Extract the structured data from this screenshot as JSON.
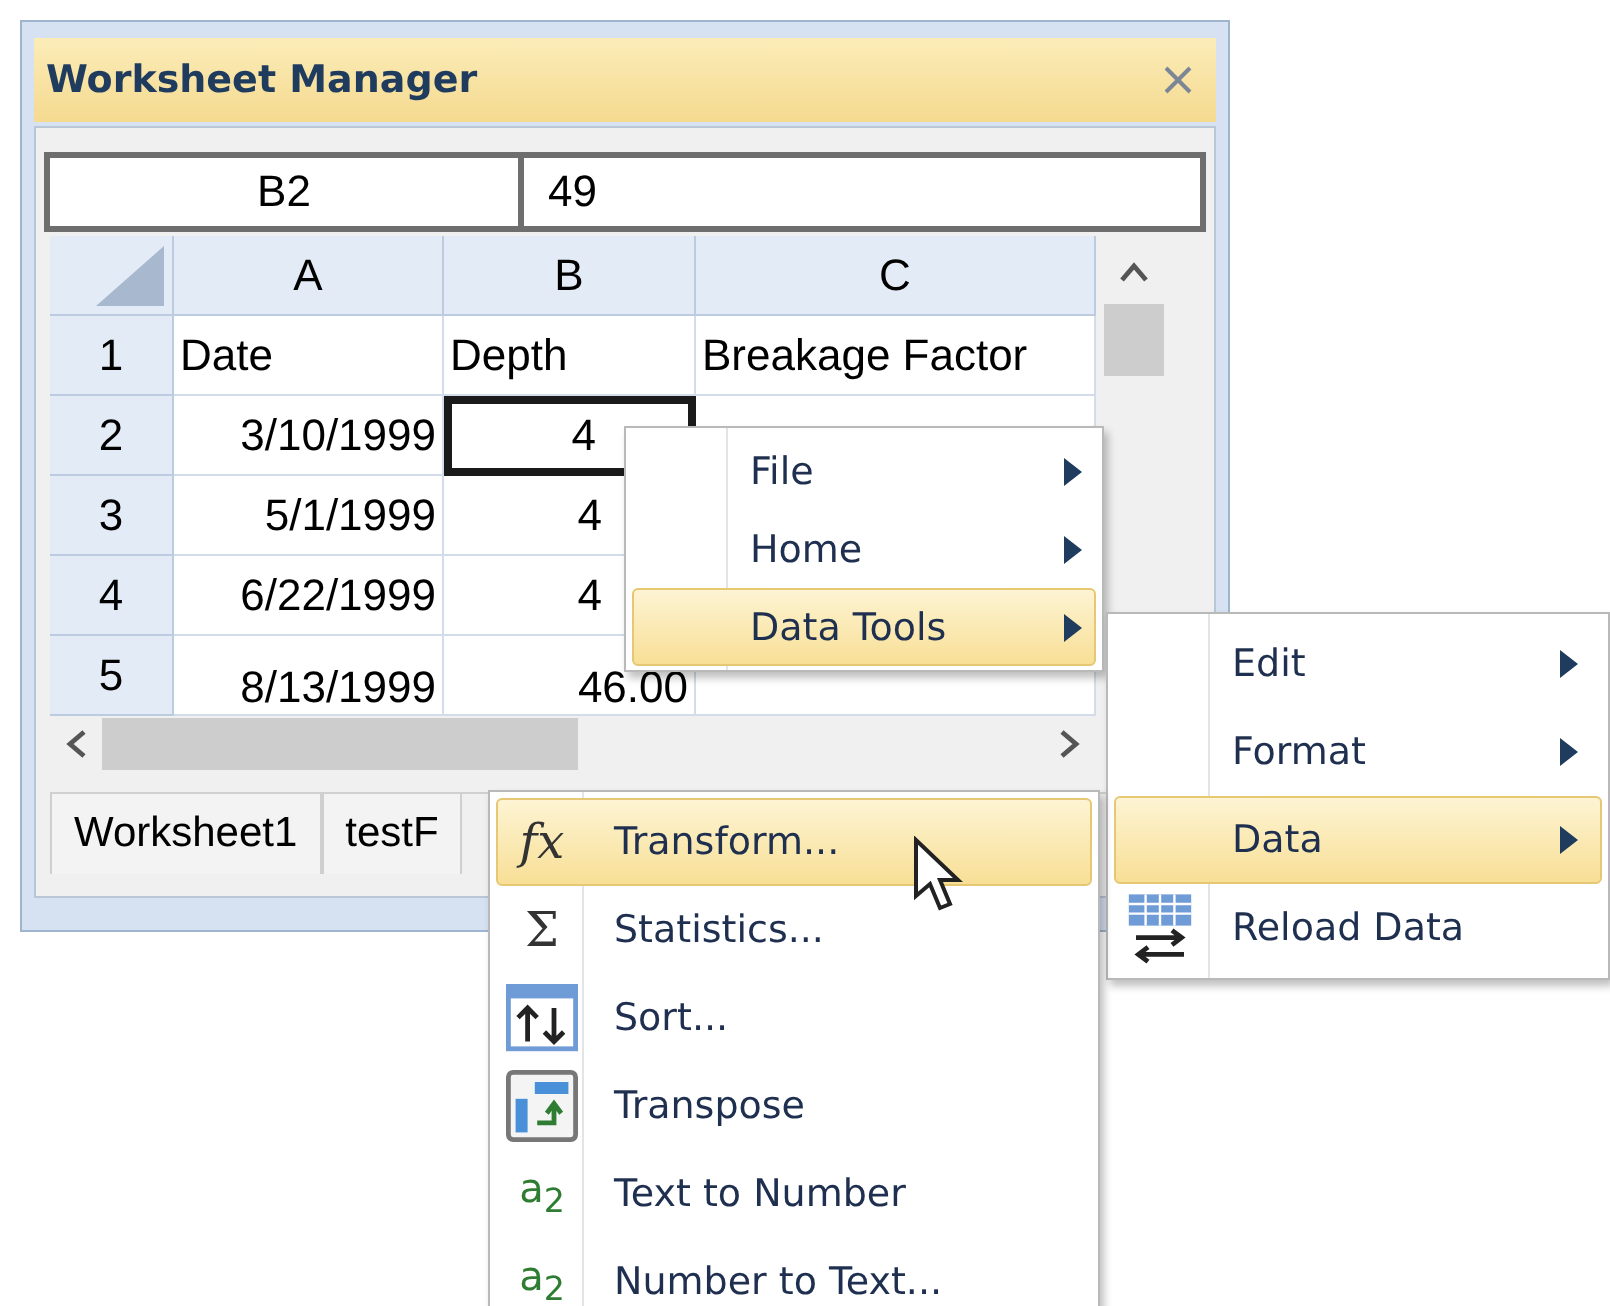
{
  "window": {
    "title": "Worksheet Manager"
  },
  "cell_reference": "B2",
  "cell_value": "49",
  "columns": [
    "A",
    "B",
    "C"
  ],
  "rows": [
    {
      "header": "1",
      "cells": [
        {
          "text": "Date",
          "kind": "text",
          "selected": false
        },
        {
          "text": "Depth",
          "kind": "text",
          "selected": false
        },
        {
          "text": "Breakage Factor",
          "kind": "text",
          "selected": false
        }
      ]
    },
    {
      "header": "2",
      "cells": [
        {
          "text": "3/10/1999",
          "kind": "number",
          "selected": false
        },
        {
          "text": "4",
          "kind": "covered",
          "selected": true
        }
      ]
    },
    {
      "header": "3",
      "cells": [
        {
          "text": "5/1/1999",
          "kind": "number",
          "selected": false
        },
        {
          "text": "4",
          "kind": "covered",
          "selected": false
        }
      ]
    },
    {
      "header": "4",
      "cells": [
        {
          "text": "6/22/1999",
          "kind": "number",
          "selected": false
        },
        {
          "text": "4",
          "kind": "covered",
          "selected": false
        }
      ]
    },
    {
      "header": "5",
      "cells": [
        {
          "text": "8/13/1999",
          "kind": "number",
          "selected": false
        },
        {
          "text": "46.00",
          "kind": "number",
          "selected": false
        },
        {
          "kind": "number",
          "selected": false
        }
      ]
    }
  ],
  "sheet_tabs": [
    "Worksheet1",
    "testF"
  ],
  "context_menu": {
    "items": [
      {
        "label": "File",
        "submenu": true,
        "selected": false
      },
      {
        "label": "Home",
        "submenu": true,
        "selected": false
      },
      {
        "label": "Data Tools",
        "submenu": true,
        "selected": true
      }
    ]
  },
  "data_tools_menu": {
    "items": [
      {
        "label": "Edit",
        "submenu": true,
        "selected": false,
        "kind": "plain"
      },
      {
        "label": "Format",
        "submenu": true,
        "selected": false,
        "kind": "plain"
      },
      {
        "label": "Data",
        "submenu": true,
        "selected": true,
        "kind": "plain"
      },
      {
        "label": "Reload Data",
        "submenu": false,
        "selected": false,
        "kind": "drawn"
      }
    ]
  },
  "data_menu": {
    "items": [
      {
        "label": "Transform...",
        "selected": true,
        "kind": "glyph",
        "glyph": "fx"
      },
      {
        "label": "Statistics...",
        "selected": false,
        "kind": "glyph",
        "glyph": "Σ"
      },
      {
        "label": "Sort...",
        "selected": false,
        "kind": "drawn"
      },
      {
        "label": "Transpose",
        "selected": false,
        "kind": "drawn"
      },
      {
        "label": "Text to Number",
        "selected": false,
        "kind": "glyph",
        "glyph": "a$_{2}$"
      },
      {
        "label": "Number to Text...",
        "selected": false,
        "kind": "glyph",
        "glyph": "a$_{2}$"
      }
    ]
  }
}
